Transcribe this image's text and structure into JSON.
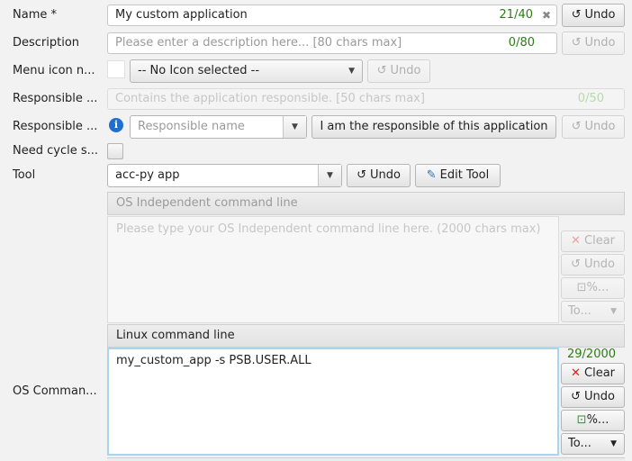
{
  "name": {
    "label": "Name *",
    "value": "My custom application",
    "counter": "21/40",
    "clear_glyph": "✖",
    "undo": "Undo"
  },
  "description": {
    "label": "Description",
    "placeholder": "Please enter a description here... [80 chars max]",
    "counter": "0/80",
    "undo": "Undo"
  },
  "menu_icon": {
    "label": "Menu icon n...",
    "selected": "-- No Icon selected --",
    "undo": "Undo"
  },
  "responsible_app": {
    "label": "Responsible ...",
    "placeholder": "Contains the application responsible. [50 chars max]",
    "counter": "0/50"
  },
  "responsible": {
    "label": "Responsible ...",
    "info_glyph": "i",
    "placeholder": "Responsible name",
    "self_button": "I am the responsible of this application",
    "undo": "Undo"
  },
  "need_cycle": {
    "label": "Need cycle s..."
  },
  "tool": {
    "label": "Tool",
    "value": "acc-py app",
    "undo": "Undo",
    "edit": "Edit Tool"
  },
  "os_commands": {
    "label": "OS Comman...",
    "independent": {
      "header": "OS Independent command line",
      "placeholder": "Please type your OS Independent command line here. (2000 chars max)",
      "clear": "Clear",
      "undo": "Undo",
      "percent": "%...",
      "to": "To..."
    },
    "linux": {
      "header": "Linux command line",
      "value": "my_custom_app -s PSB.USER.ALL",
      "counter": "29/2000",
      "clear": "Clear",
      "undo": "Undo",
      "percent": "%...",
      "to": "To..."
    }
  },
  "icons": {
    "undo": "undo-arrow-icon",
    "dropdown": "chevron-down-icon",
    "clear": "red-x-icon",
    "edit_tool": "edit-tool-icon",
    "percent": "insert-variable-icon",
    "info": "info-icon"
  },
  "colors": {
    "counter_green": "#2b7d14",
    "info_blue": "#1f6fd1",
    "clear_red": "#d22222",
    "focus_border": "#a9d6ec"
  }
}
